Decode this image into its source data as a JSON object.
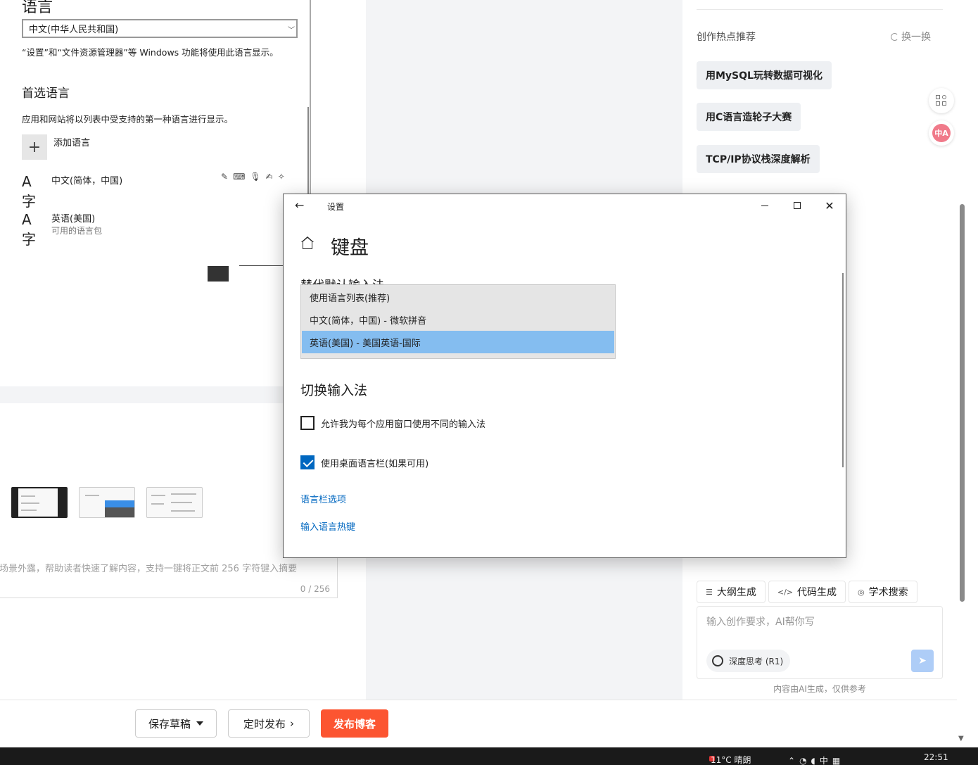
{
  "language_window": {
    "heading": "语言",
    "display_language": "中文(中华人民共和国)",
    "display_note": "“设置”和“文件资源管理器”等 Windows 功能将使用此语言显示。",
    "preferred_title": "首选语言",
    "preferred_note": "应用和网站将以列表中受支持的第一种语言进行显示。",
    "add_language": "添加语言",
    "languages": [
      {
        "glyph": "A字",
        "name": "中文(简体，中国)",
        "sub": ""
      },
      {
        "glyph": "A字",
        "name": "英语(美国)",
        "sub": "可用的语言包"
      }
    ]
  },
  "keyboard_dialog": {
    "window_title": "设置",
    "heading": "键盘",
    "partial_label": "替代默认输入法",
    "dropdown_options": [
      {
        "label": "使用语言列表(推荐)",
        "selected": false
      },
      {
        "label": "中文(简体，中国) - 微软拼音",
        "selected": false
      },
      {
        "label": "英语(美国) - 美国英语-国际",
        "selected": true
      }
    ],
    "switch_section": "切换输入法",
    "checkboxes": [
      {
        "label": "允许我为每个应用窗口使用不同的输入法",
        "checked": false
      },
      {
        "label": "使用桌面语言栏(如果可用)",
        "checked": true
      }
    ],
    "links": [
      "语言栏选项",
      "输入语言热键"
    ]
  },
  "editor": {
    "summary_placeholder": "场景外露，帮助读者快速了解内容，支持一键将正文前 256 字符键入摘要",
    "summary_count": "0 / 256",
    "save_draft": "保存草稿",
    "schedule": "定时发布",
    "publish": "发布博客"
  },
  "right_panel": {
    "title": "创作热点推荐",
    "refresh": "换一换",
    "hot_tags": [
      "用MySQL玩转数据可视化",
      "用C语言造轮子大赛",
      "TCP/IP协议栈深度解析"
    ],
    "ai_tabs": [
      {
        "icon": "list-icon",
        "label": "大纲生成"
      },
      {
        "icon": "code-icon",
        "label": "代码生成"
      },
      {
        "icon": "scholar-icon",
        "label": "学术搜索"
      }
    ],
    "ai_placeholder": "输入创作要求，AI帮你写",
    "deep_think": "深度思考 (R1)",
    "ai_note": "内容由AI生成，仅供参考"
  },
  "taskbar": {
    "weather": "11°C  晴朗",
    "ime": "中",
    "clock": "22:51"
  },
  "colors": {
    "publish": "#fc5531",
    "link": "#0067c0",
    "selected_option": "#84bdf0",
    "checkbox_on": "#0067c0"
  }
}
